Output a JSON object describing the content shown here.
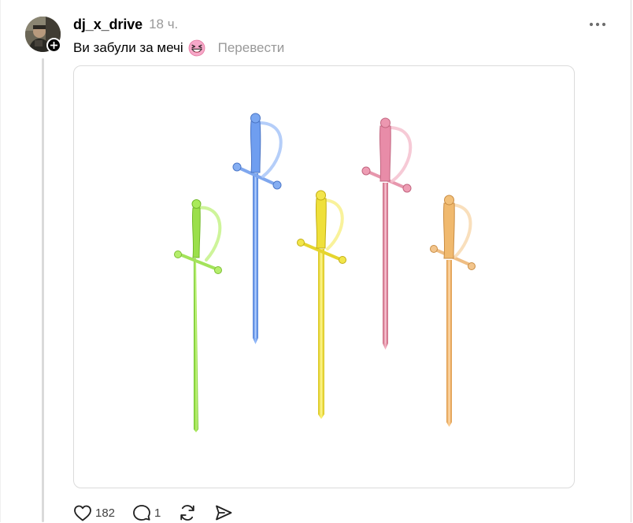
{
  "post": {
    "author": {
      "username": "dj_x_drive",
      "avatar_icon": "avatar-photo",
      "follow_badge_icon": "plus-icon"
    },
    "timestamp": "18 ч.",
    "text": "Ви забули за мечі",
    "emoji": "grinning-squinting-face-icon",
    "translate_label": "Перевести",
    "more_icon": "more-horizontal-icon",
    "media": {
      "description_icon": "swords-image",
      "sword_colors": [
        "#93e13f",
        "#6f9ef0",
        "#f1e43a",
        "#e88ca8",
        "#f0b96e"
      ]
    },
    "actions": {
      "like_icon": "heart-icon",
      "like_count": "182",
      "reply_icon": "comment-icon",
      "reply_count": "1",
      "repost_icon": "repost-icon",
      "share_icon": "share-icon"
    }
  },
  "colors": {
    "text_primary": "#000000",
    "text_secondary": "#999999",
    "border": "#dbdbdb",
    "thread_line": "#dadada"
  }
}
